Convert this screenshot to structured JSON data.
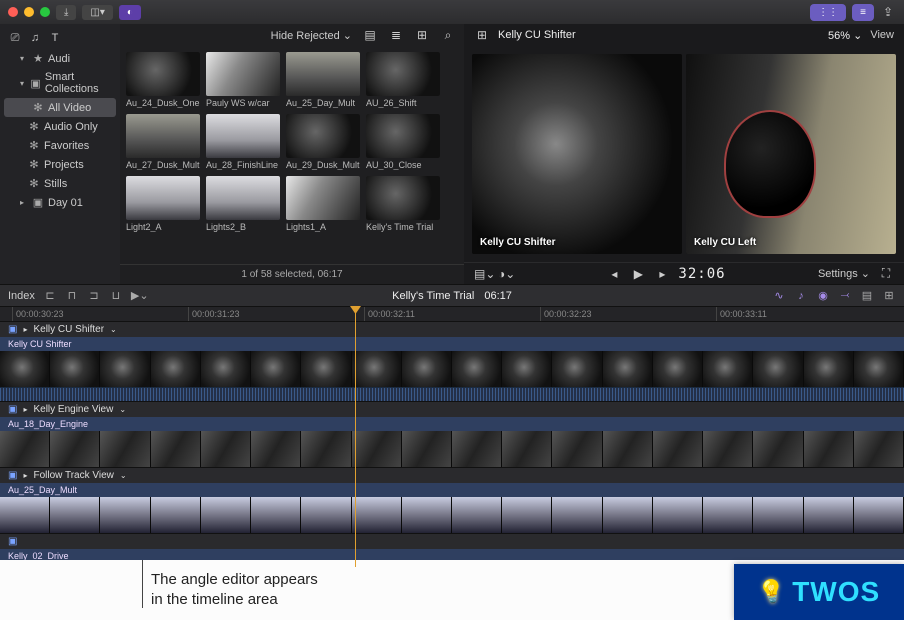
{
  "window": {
    "tooltips": {
      "import": "Import"
    }
  },
  "toolbar_right": {
    "btn1": "⋮⋮",
    "btn2": "≡",
    "btn3": "⧉"
  },
  "sidebar": {
    "project": "Audi",
    "smart": "Smart Collections",
    "items": [
      {
        "label": "All Video",
        "selected": true,
        "glyph": "✻"
      },
      {
        "label": "Audio Only",
        "glyph": "✻"
      },
      {
        "label": "Favorites",
        "glyph": "✻"
      },
      {
        "label": "Projects",
        "glyph": "✻"
      },
      {
        "label": "Stills",
        "glyph": "✻"
      }
    ],
    "day": "Day 01"
  },
  "browser": {
    "filter_label": "Hide Rejected",
    "clips": [
      {
        "name": "Au_24_Dusk_One",
        "cls": "dark"
      },
      {
        "name": "Pauly WS w/car",
        "cls": "car"
      },
      {
        "name": "Au_25_Day_Mult",
        "cls": "road"
      },
      {
        "name": "AU_26_Shift",
        "cls": "dark"
      },
      {
        "name": "Au_27_Dusk_Mult",
        "cls": "road"
      },
      {
        "name": "Au_28_FinishLine",
        "cls": "light"
      },
      {
        "name": "Au_29_Dusk_Mult",
        "cls": "dark"
      },
      {
        "name": "AU_30_Close",
        "cls": "dark"
      },
      {
        "name": "Light2_A",
        "cls": "light"
      },
      {
        "name": "Lights2_B",
        "cls": "light"
      },
      {
        "name": "Lights1_A",
        "cls": "car"
      },
      {
        "name": "Kelly's Time Trial",
        "cls": "dark"
      }
    ],
    "footer": "1 of 58 selected, 06:17"
  },
  "viewer": {
    "grid_icon": "⊞",
    "title": "Kelly CU Shifter",
    "zoom": "56%",
    "view_label": "View",
    "angles": [
      {
        "label": "Kelly CU Shifter",
        "cls": "shifter"
      },
      {
        "label": "Kelly CU Left",
        "cls": "left"
      }
    ],
    "settings": "Settings",
    "timecode": "32:06",
    "play_icon": "▶"
  },
  "tl_toolbar": {
    "index": "Index",
    "title": "Kelly's Time Trial",
    "duration": "06:17"
  },
  "ruler": {
    "ticks": [
      "00:00:30:23",
      "00:00:31:23",
      "00:00:32:11",
      "00:00:32:23",
      "00:00:33:11"
    ]
  },
  "tracks": [
    {
      "name": "Kelly CU Shifter",
      "tag": "Kelly CU Shifter",
      "frames": "shifter",
      "audio": true
    },
    {
      "name": "Kelly Engine View",
      "tag": "Au_18_Day_Engine",
      "frames": "engine",
      "audio": false
    },
    {
      "name": "Follow Track View",
      "tag": "Au_25_Day_Mult",
      "frames": "daycar",
      "audio": false
    },
    {
      "name": "",
      "tag": "Kelly_02_Drive",
      "frames": "",
      "audio": false,
      "collapsed": true
    }
  ],
  "caption": {
    "line1": "The angle editor appears",
    "line2": "in the timeline area"
  },
  "brand": "TWOS"
}
